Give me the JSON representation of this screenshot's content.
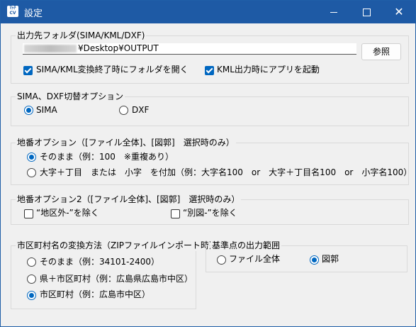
{
  "window": {
    "title": "設定",
    "icon_text": "ﾏｯﾁ CV",
    "icon_name": "app-icon",
    "controls": {
      "minimize": "minimize-icon",
      "maximize": "maximize-icon",
      "close": "close-icon",
      "close_glyph": "✕"
    },
    "accent_color": "#1e5aa5"
  },
  "output": {
    "group_title": "出力先フォルダ(SIMA/KML/DXF)",
    "path_value": "¥Desktop¥OUTPUT",
    "browse_label": "参照",
    "open_folder_label": "SIMA/KML変換終了時にフォルダを開く",
    "open_folder_checked": true,
    "launch_app_label": "KML出力時にアプリを起動",
    "launch_app_checked": true
  },
  "sima_dxf": {
    "group_title": "SIMA、DXF切替オプション",
    "options": [
      {
        "label": "SIMA",
        "selected": true
      },
      {
        "label": "DXF",
        "selected": false
      }
    ]
  },
  "chiban": {
    "group_title": "地番オプション（[ファイル全体]、[図郭]　選択時のみ）",
    "options": [
      {
        "label": "そのまま（例：100　※重複あり）",
        "selected": true
      },
      {
        "label": "大字＋丁目　または　小字　を付加（例：大字名100　or　大字＋丁目名100　or　小字名100）",
        "selected": false
      }
    ]
  },
  "chiban2": {
    "group_title": "地番オプション2（[ファイル全体]、[図郭]　選択時のみ）",
    "options": [
      {
        "label": "“地区外-”を除く",
        "checked": false
      },
      {
        "label": "“別図-”を除く",
        "checked": false
      }
    ]
  },
  "city": {
    "group_title": "市区町村名の変換方法（ZIPファイルインポート時）",
    "options": [
      {
        "label": "そのまま（例：34101-2400）",
        "selected": false
      },
      {
        "label": "県＋市区町村（例：広島県広島市中区）",
        "selected": false
      },
      {
        "label": "市区町村（例：広島市中区）",
        "selected": true
      }
    ]
  },
  "reference": {
    "group_title": "基準点の出力範囲",
    "options": [
      {
        "label": "ファイル全体",
        "selected": false
      },
      {
        "label": "図郭",
        "selected": true
      }
    ]
  }
}
